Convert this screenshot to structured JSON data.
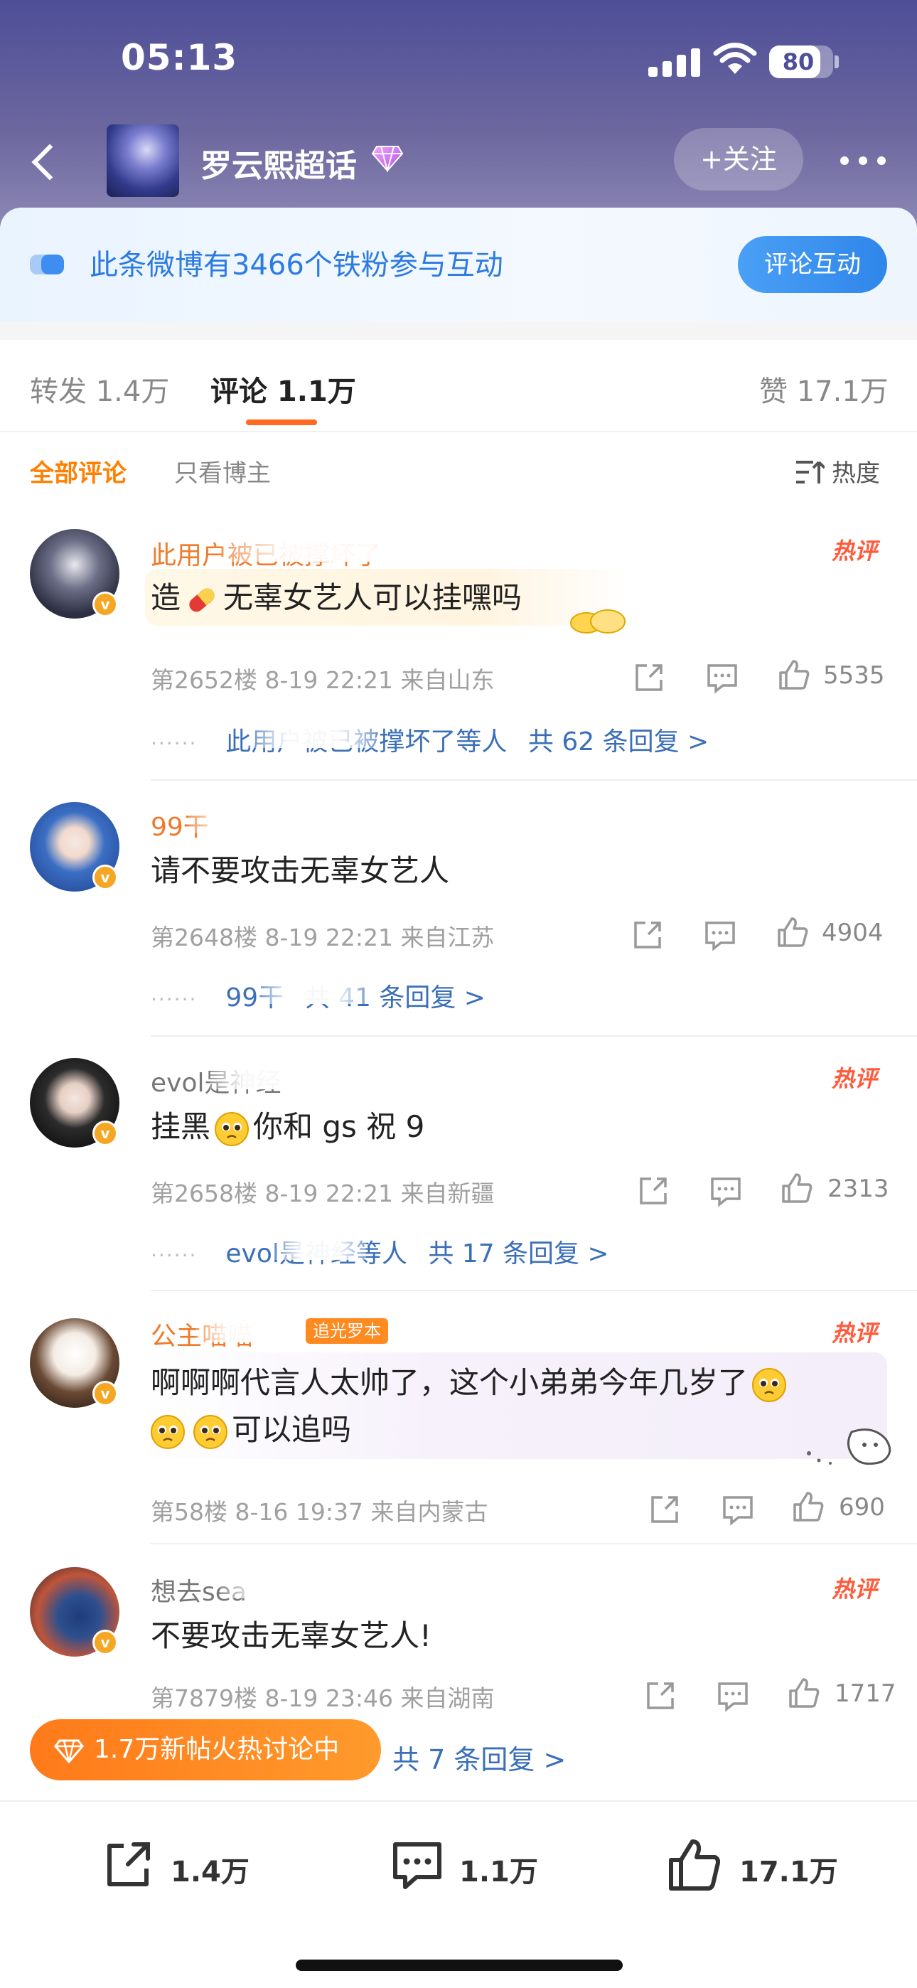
{
  "status_bar": {
    "time": "05:13",
    "battery": "80",
    "battery_level": 0.8
  },
  "header": {
    "title": "罗云熙超话",
    "follow_label": "+关注"
  },
  "fan_banner": {
    "text": "此条微博有3466个铁粉参与互动",
    "button_label": "评论互动"
  },
  "tabs": {
    "repost": "转发 1.4万",
    "comment": "评论 1.1万",
    "like": "赞 17.1万"
  },
  "filter": {
    "all_label": "全部评论",
    "author_only_label": "只看博主",
    "sort_label": "热度"
  },
  "comments": [
    {
      "username": "此用户被已被撑坏了",
      "hot_tag": "热评",
      "text_before": "造",
      "text_after": "无辜女艺人可以挂嘿吗",
      "floor": "第2652楼",
      "time": "8-19 22:21",
      "location": "来自山东",
      "likes": "5535",
      "replies": "此用户被已被撑坏了等人",
      "reply_count": "共 62 条回复 >"
    },
    {
      "username": "99干",
      "text": "请不要攻击无辜女艺人",
      "floor": "第2648楼",
      "time": "8-19 22:21",
      "location": "来自江苏",
      "likes": "4904",
      "replies": "99干",
      "reply_count": "共 41 条回复 >"
    },
    {
      "username": "evol是神经",
      "hot_tag": "热评",
      "text_before": "挂黑",
      "text_after": "你和 gs 祝 9",
      "floor": "第2658楼",
      "time": "8-19 22:21",
      "location": "来自新疆",
      "likes": "2313",
      "replies": "evol是神经等人",
      "reply_count": "共 17 条回复 >"
    },
    {
      "username": "公主喵喵",
      "badge": "追光罗本",
      "hot_tag": "热评",
      "text_line1": "啊啊啊代言人太帅了，这个小弟弟今年几岁了",
      "text_line2": "可以追吗",
      "floor": "第58楼",
      "time": "8-16 19:37",
      "location": "来自内蒙古",
      "likes": "690"
    },
    {
      "username": "想去sea",
      "hot_tag": "热评",
      "text": "不要攻击无辜女艺人!",
      "floor": "第7879楼",
      "time": "8-19 23:46",
      "location": "来自湖南",
      "likes": "1717",
      "reply_count": "共 7 条回复 >"
    }
  ],
  "fire_banner": {
    "text": "1.7万新帖火热讨论中"
  },
  "bottom_bar": {
    "repost_count": "1.4万",
    "comment_count": "1.1万",
    "like_count": "17.1万"
  },
  "colors": {
    "header_top": "#4e4e98",
    "accent_orange": "#ff8000",
    "link_blue": "#3b6fb8",
    "banner_blue": "#2d7be0",
    "hot_red": "#ff5a3a"
  },
  "icons": [
    "back-icon",
    "diamond-icon",
    "more-icon",
    "fan-icon",
    "sort-icon",
    "share-icon",
    "comment-icon",
    "like-icon",
    "fire-icon"
  ]
}
